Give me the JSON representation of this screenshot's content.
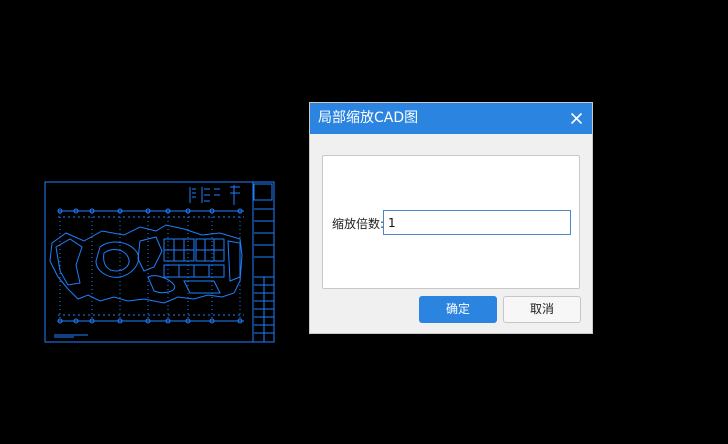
{
  "dialog": {
    "title": "局部缩放CAD图",
    "close_icon": "close-icon",
    "field_label": "缩放倍数:",
    "field_value": "1",
    "ok_label": "确定",
    "cancel_label": "取消"
  },
  "colors": {
    "background": "#000000",
    "cad_line": "#1e7fff",
    "titlebar": "#2b84e0",
    "dialog_body": "#f0f0f0",
    "ok_button": "#2b84e0"
  }
}
